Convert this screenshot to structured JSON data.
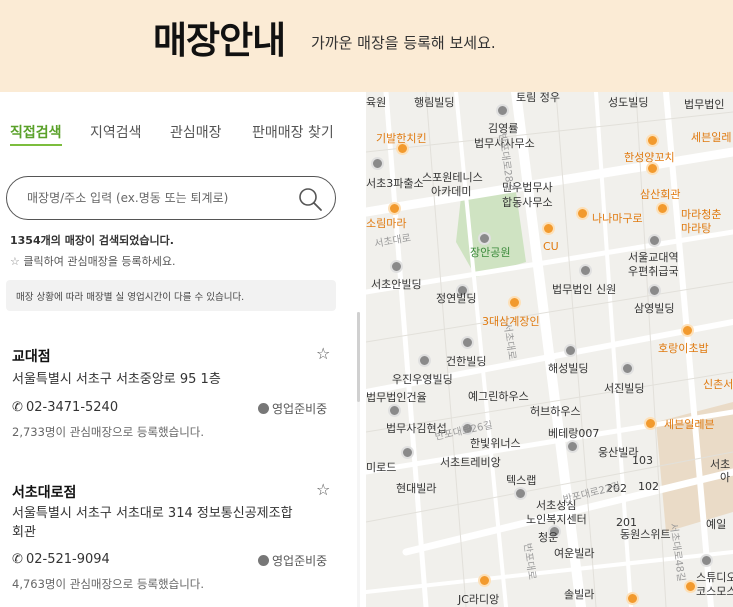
{
  "header": {
    "title": "매장안내",
    "subtitle": "가까운 매장을 등록해 보세요."
  },
  "tabs": [
    {
      "label": "직접검색",
      "active": true
    },
    {
      "label": "지역검색",
      "active": false
    },
    {
      "label": "관심매장",
      "active": false
    },
    {
      "label": "판매매장 찾기",
      "active": false
    }
  ],
  "search": {
    "placeholder": "매장명/주소 입력 (ex.명동 또는 퇴계로)",
    "icon": "search-icon"
  },
  "results": {
    "count_number": "1354",
    "count_suffix": "개의 매장이 검색되었습니다.",
    "hint": "클릭하여 관심매장을 등록하세요.",
    "notice": "매장 상황에 따라 매장별 실 영업시간이 다를 수 있습니다."
  },
  "stores": [
    {
      "name": "교대점",
      "address": "서울특별시 서초구 서초중앙로 95 1층",
      "phone": "02-3471-5240",
      "status": "영업준비중",
      "favorites": "2,733명이 관심매장으로 등록했습니다."
    },
    {
      "name": "서초대로점",
      "address": "서울특별시 서초구 서초대로 314 정보통신공제조합회관",
      "phone": "02-521-9094",
      "status": "영업준비중",
      "favorites": "4,763명이 관심매장으로 등록했습니다."
    }
  ],
  "map": {
    "labels": [
      "육원",
      "행림빌딩",
      "토림 정우",
      "성도빌딩",
      "법무법인",
      "김영률",
      "법무사사무소",
      "기발한치킨",
      "세븐일레",
      "스포원테니스",
      "아카데미",
      "민우법무사",
      "합동사무소",
      "한성양꼬치",
      "서초3파출소",
      "삼산회관",
      "소림마라",
      "장안공원",
      "CU",
      "나나마구로",
      "마라청춘",
      "마라탕",
      "서울교대역",
      "우편취급국",
      "서초안빌딩",
      "정연빌딩",
      "법무법인 신원",
      "삼영빌딩",
      "3대삼계장인",
      "건한빌딩",
      "호랑이초밥",
      "해성빌딩",
      "우진우영빌딩",
      "서진빌딩",
      "신촌서",
      "법무법인건율",
      "예그린하우스",
      "허브하우스",
      "법무사김현섭",
      "베테랑007",
      "세븐일레븐",
      "한빛위너스",
      "웅산빌라",
      "서초",
      "미로드",
      "서초트레비앙",
      "아",
      "103",
      "텍스랩",
      "현대빌라",
      "202",
      "102",
      "서초성심",
      "노인복지센터",
      "201",
      "동원스위트",
      "예일",
      "청운",
      "여운빌라",
      "스튜디오",
      "코스모스",
      "JC라디앙",
      "솔빌라"
    ],
    "roads": [
      "반포대로28길",
      "서초대로",
      "반포대로26길",
      "서초대로",
      "반포대로22길",
      "서초대로48길",
      "반포대로"
    ]
  }
}
